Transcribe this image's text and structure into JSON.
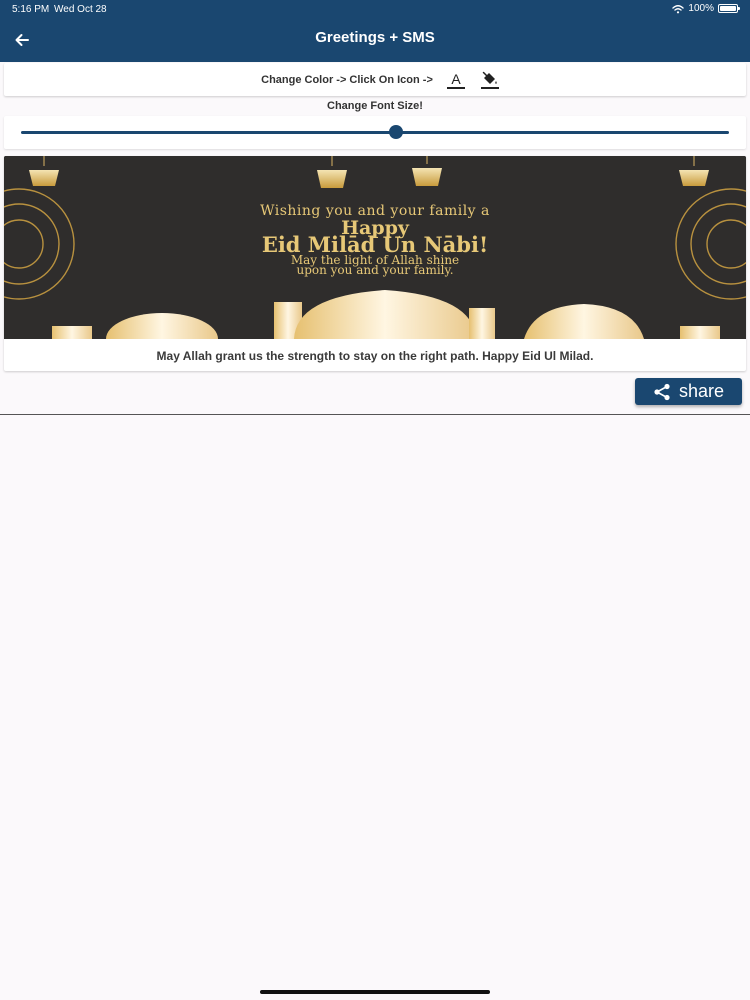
{
  "status_bar": {
    "time": "5:16 PM",
    "date": "Wed Oct 28",
    "battery_text": "100%",
    "battery_level": 1.0
  },
  "header": {
    "title": "Greetings + SMS",
    "back_icon": "arrow-left-icon"
  },
  "color_section": {
    "label": "Change Color -> Click On Icon ->",
    "text_color_icon": "text-color-icon",
    "text_color_letter": "A",
    "fill_color_icon": "paint-bucket-icon"
  },
  "font_size_section": {
    "label": "Change Font Size!",
    "slider_value": 0.53
  },
  "greeting_card": {
    "image_lines": [
      "Wishing you and your family a",
      "Happy",
      "Eid Milād Un Nābi!",
      "May the light of Allah shine",
      "upon you and your family."
    ],
    "message": "May Allah grant us the strength to stay on the right path. Happy Eid Ul Milad."
  },
  "share": {
    "label": "share",
    "icon": "share-icon"
  },
  "colors": {
    "primary": "#1a4770",
    "gold": "#e7c877",
    "image_background": "#2f2d2c"
  }
}
